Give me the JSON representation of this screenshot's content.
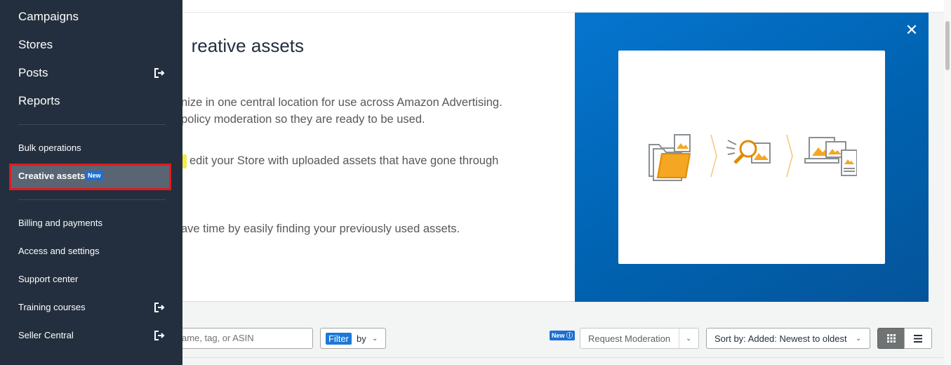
{
  "sidebar": {
    "primary": [
      {
        "label": "Campaigns"
      },
      {
        "label": "Stores"
      },
      {
        "label": "Posts",
        "external_icon": "external-link-icon"
      },
      {
        "label": "Reports"
      }
    ],
    "tools": [
      {
        "label": "Bulk operations"
      },
      {
        "label": "Creative assets",
        "badge": "New",
        "active": true
      }
    ],
    "account": [
      {
        "label": "Billing and payments"
      },
      {
        "label": "Access and settings"
      },
      {
        "label": "Support center"
      },
      {
        "label": "Training courses",
        "external_icon": "external-link-icon"
      },
      {
        "label": "Seller Central",
        "external_icon": "external-link-icon"
      }
    ]
  },
  "intro": {
    "title": "reative assets",
    "line1": "nize in one central location for use across Amazon Advertising.",
    "line2": "policy moderation so they are ready to be used.",
    "line3": "edit your Store with uploaded assets that have gone through",
    "line4": "ave time by easily finding your previously used assets."
  },
  "promo": {
    "close_icon": "close-icon",
    "illustration_icons": [
      "upload-folder-icon",
      "review-magnifier-icon",
      "devices-icon"
    ],
    "accent_color": "#0070c9"
  },
  "toolbar": {
    "search_value": "ame, tag, or ASIN",
    "filter_tag": "Filter",
    "filter_suffix": "by",
    "new_badge": "New",
    "request_moderation": "Request Moderation",
    "sort_label": "Sort by: Added: Newest to oldest",
    "view_grid_icon": "grid-view-icon",
    "view_list_icon": "list-view-icon"
  }
}
